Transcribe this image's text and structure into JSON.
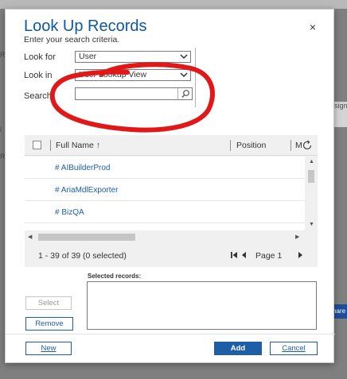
{
  "dialog": {
    "title": "Look Up Records",
    "subtitle": "Enter your search criteria.",
    "close_glyph": "×"
  },
  "form": {
    "look_for_label": "Look for",
    "look_for_value": "User",
    "look_in_label": "Look in",
    "look_in_value": "User Lookup View",
    "search_label": "Search",
    "search_value": "",
    "search_placeholder": ""
  },
  "grid": {
    "columns": [
      "Full Name ↑",
      "Position",
      "M"
    ],
    "rows": [
      {
        "name": "# AIBuilderProd"
      },
      {
        "name": "# AriaMdlExporter"
      },
      {
        "name": "# BizQA"
      }
    ],
    "status": "1 - 39 of 39 (0 selected)",
    "page_label": "Page 1"
  },
  "selected": {
    "label": "Selected records:"
  },
  "buttons": {
    "select": "Select",
    "remove": "Remove",
    "new": "New",
    "add": "Add",
    "cancel": "Cancel"
  },
  "background": {
    "left_fragments": [
      "Re",
      "l",
      "R"
    ],
    "right_fragments": [
      "sign",
      "hare"
    ]
  },
  "colors": {
    "title": "#0f56a3",
    "primary": "#1e5ea7",
    "annotation": "#e01818"
  },
  "icons": [
    "close-icon",
    "chevron-down-icon",
    "search-icon",
    "refresh-icon",
    "sort-up-icon",
    "first-page-icon",
    "previous-page-icon",
    "next-page-icon"
  ]
}
